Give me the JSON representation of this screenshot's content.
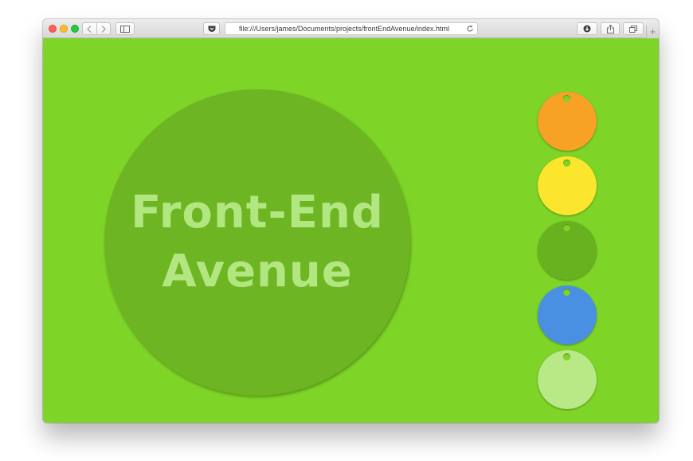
{
  "browser": {
    "url": "file:///Users/james/Documents/projects/frontEndAvenue/index.html",
    "back_icon": "chevron-left-icon",
    "forward_icon": "chevron-right-icon",
    "sidebar_icon": "sidebar-icon",
    "pocket_icon": "pocket-icon",
    "reload_icon": "reload-icon",
    "download_icon": "download-icon",
    "share_icon": "share-icon",
    "tabs_icon": "tabs-icon",
    "new_tab_label": "+"
  },
  "page": {
    "background_color": "#7ed427",
    "hero": {
      "line1": "Front-End",
      "line2": "Avenue",
      "circle_color": "#6db522",
      "text_color": "#b2e680"
    },
    "swatches": [
      {
        "name": "orange",
        "color": "#f7a125"
      },
      {
        "name": "yellow",
        "color": "#fbe52d"
      },
      {
        "name": "green",
        "color": "#69b21f"
      },
      {
        "name": "blue",
        "color": "#4a90e2"
      },
      {
        "name": "light-green",
        "color": "#b8e986"
      }
    ]
  }
}
